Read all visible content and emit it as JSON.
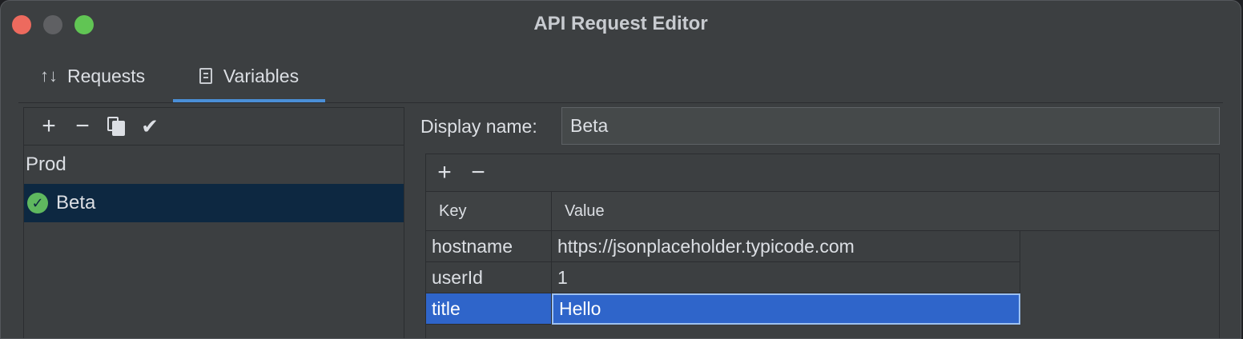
{
  "window": {
    "title": "API Request Editor"
  },
  "tabs": [
    {
      "label": "Requests",
      "icon": "sort-arrows-icon",
      "active": false
    },
    {
      "label": "Variables",
      "icon": "document-icon",
      "active": true
    }
  ],
  "environments": {
    "toolbar": [
      "add",
      "remove",
      "copy",
      "set-default"
    ],
    "items": [
      {
        "label": "Prod",
        "selected": false,
        "default": false
      },
      {
        "label": "Beta",
        "selected": true,
        "default": true
      }
    ]
  },
  "display_name": {
    "label": "Display name:",
    "value": "Beta"
  },
  "variables_table": {
    "headers": {
      "key": "Key",
      "value": "Value"
    },
    "rows": [
      {
        "key": "hostname",
        "value": "https://jsonplaceholder.typicode.com"
      },
      {
        "key": "userId",
        "value": "1"
      },
      {
        "key": "title",
        "value": "Hello"
      }
    ]
  },
  "colors": {
    "accent": "#4a8fd7",
    "selection": "#2f65ca",
    "list_selection": "#0d2841",
    "check": "#5fb85f"
  }
}
